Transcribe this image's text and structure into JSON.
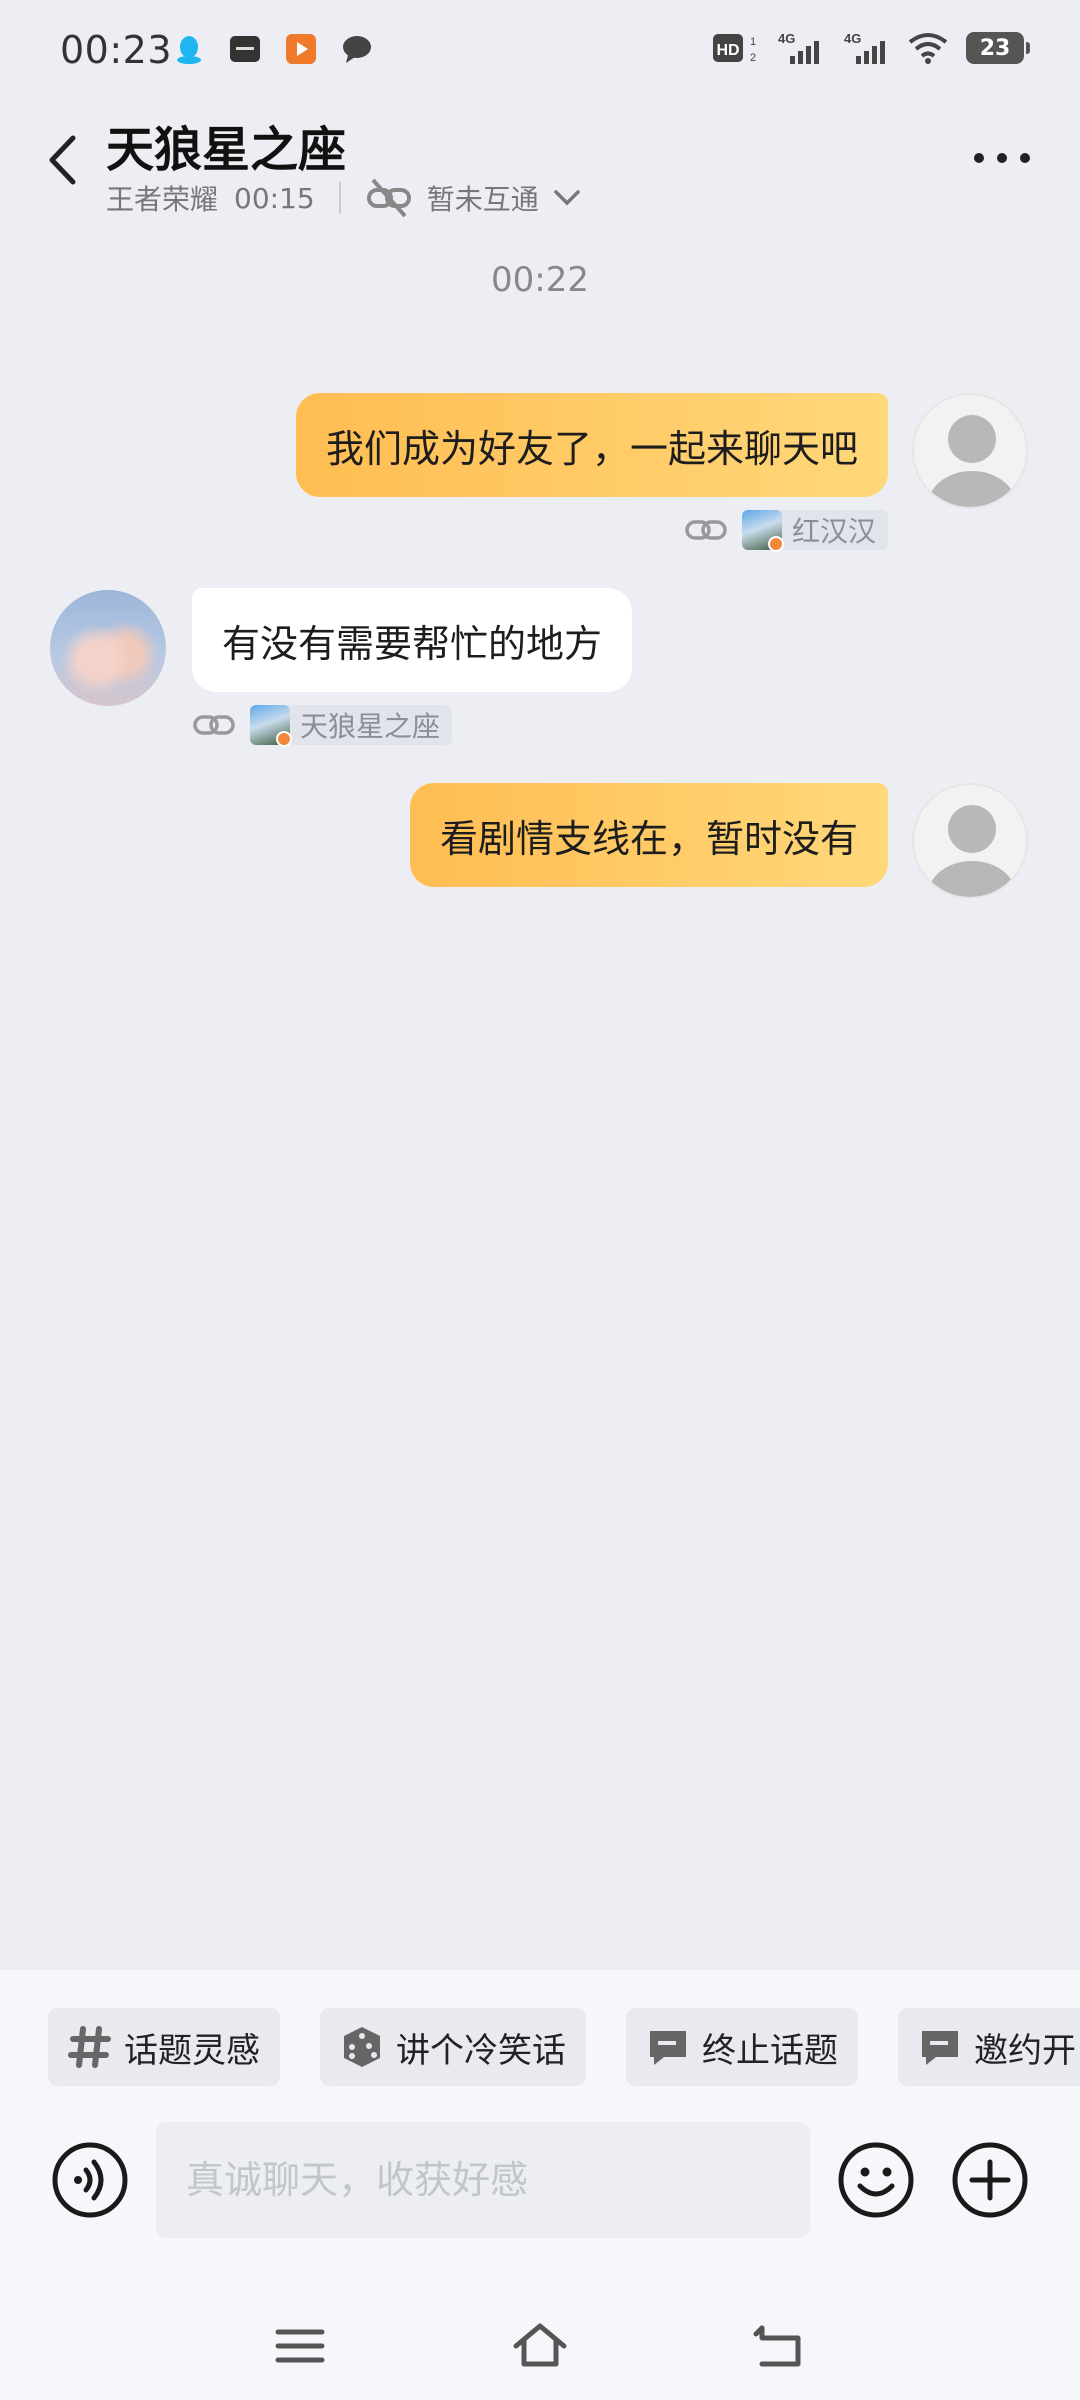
{
  "status_bar": {
    "time": "00:23",
    "notification_icons": [
      "qq-icon",
      "vivo-icon",
      "video-app-icon",
      "message-icon"
    ],
    "hd_label": "HD",
    "signal_label_1": "4G",
    "signal_label_2": "4G",
    "battery": "23"
  },
  "header": {
    "title": "天狼星之座",
    "game": "王者荣耀",
    "game_time": "00:15",
    "connect_status": "暂未互通"
  },
  "chat": {
    "time_divider": "00:22",
    "messages": [
      {
        "side": "mine",
        "text": "我们成为好友了，一起来聊天吧",
        "source_name": "红汉汉"
      },
      {
        "side": "theirs",
        "text": "有没有需要帮忙的地方",
        "source_name": "天狼星之座"
      },
      {
        "side": "mine",
        "text": "看剧情支线在，暂时没有"
      }
    ]
  },
  "quick_actions": [
    {
      "label": "话题灵感",
      "icon": "hashtag-icon"
    },
    {
      "label": "讲个冷笑话",
      "icon": "dice-icon"
    },
    {
      "label": "终止话题",
      "icon": "speech-bubble-icon"
    },
    {
      "label": "邀约开",
      "icon": "speech-bubble-icon"
    }
  ],
  "input": {
    "placeholder": "真诚聊天，收获好感"
  },
  "colors": {
    "mine_bubble_start": "#ffbd52",
    "mine_bubble_end": "#ffd87a",
    "background": "#edeef4"
  }
}
